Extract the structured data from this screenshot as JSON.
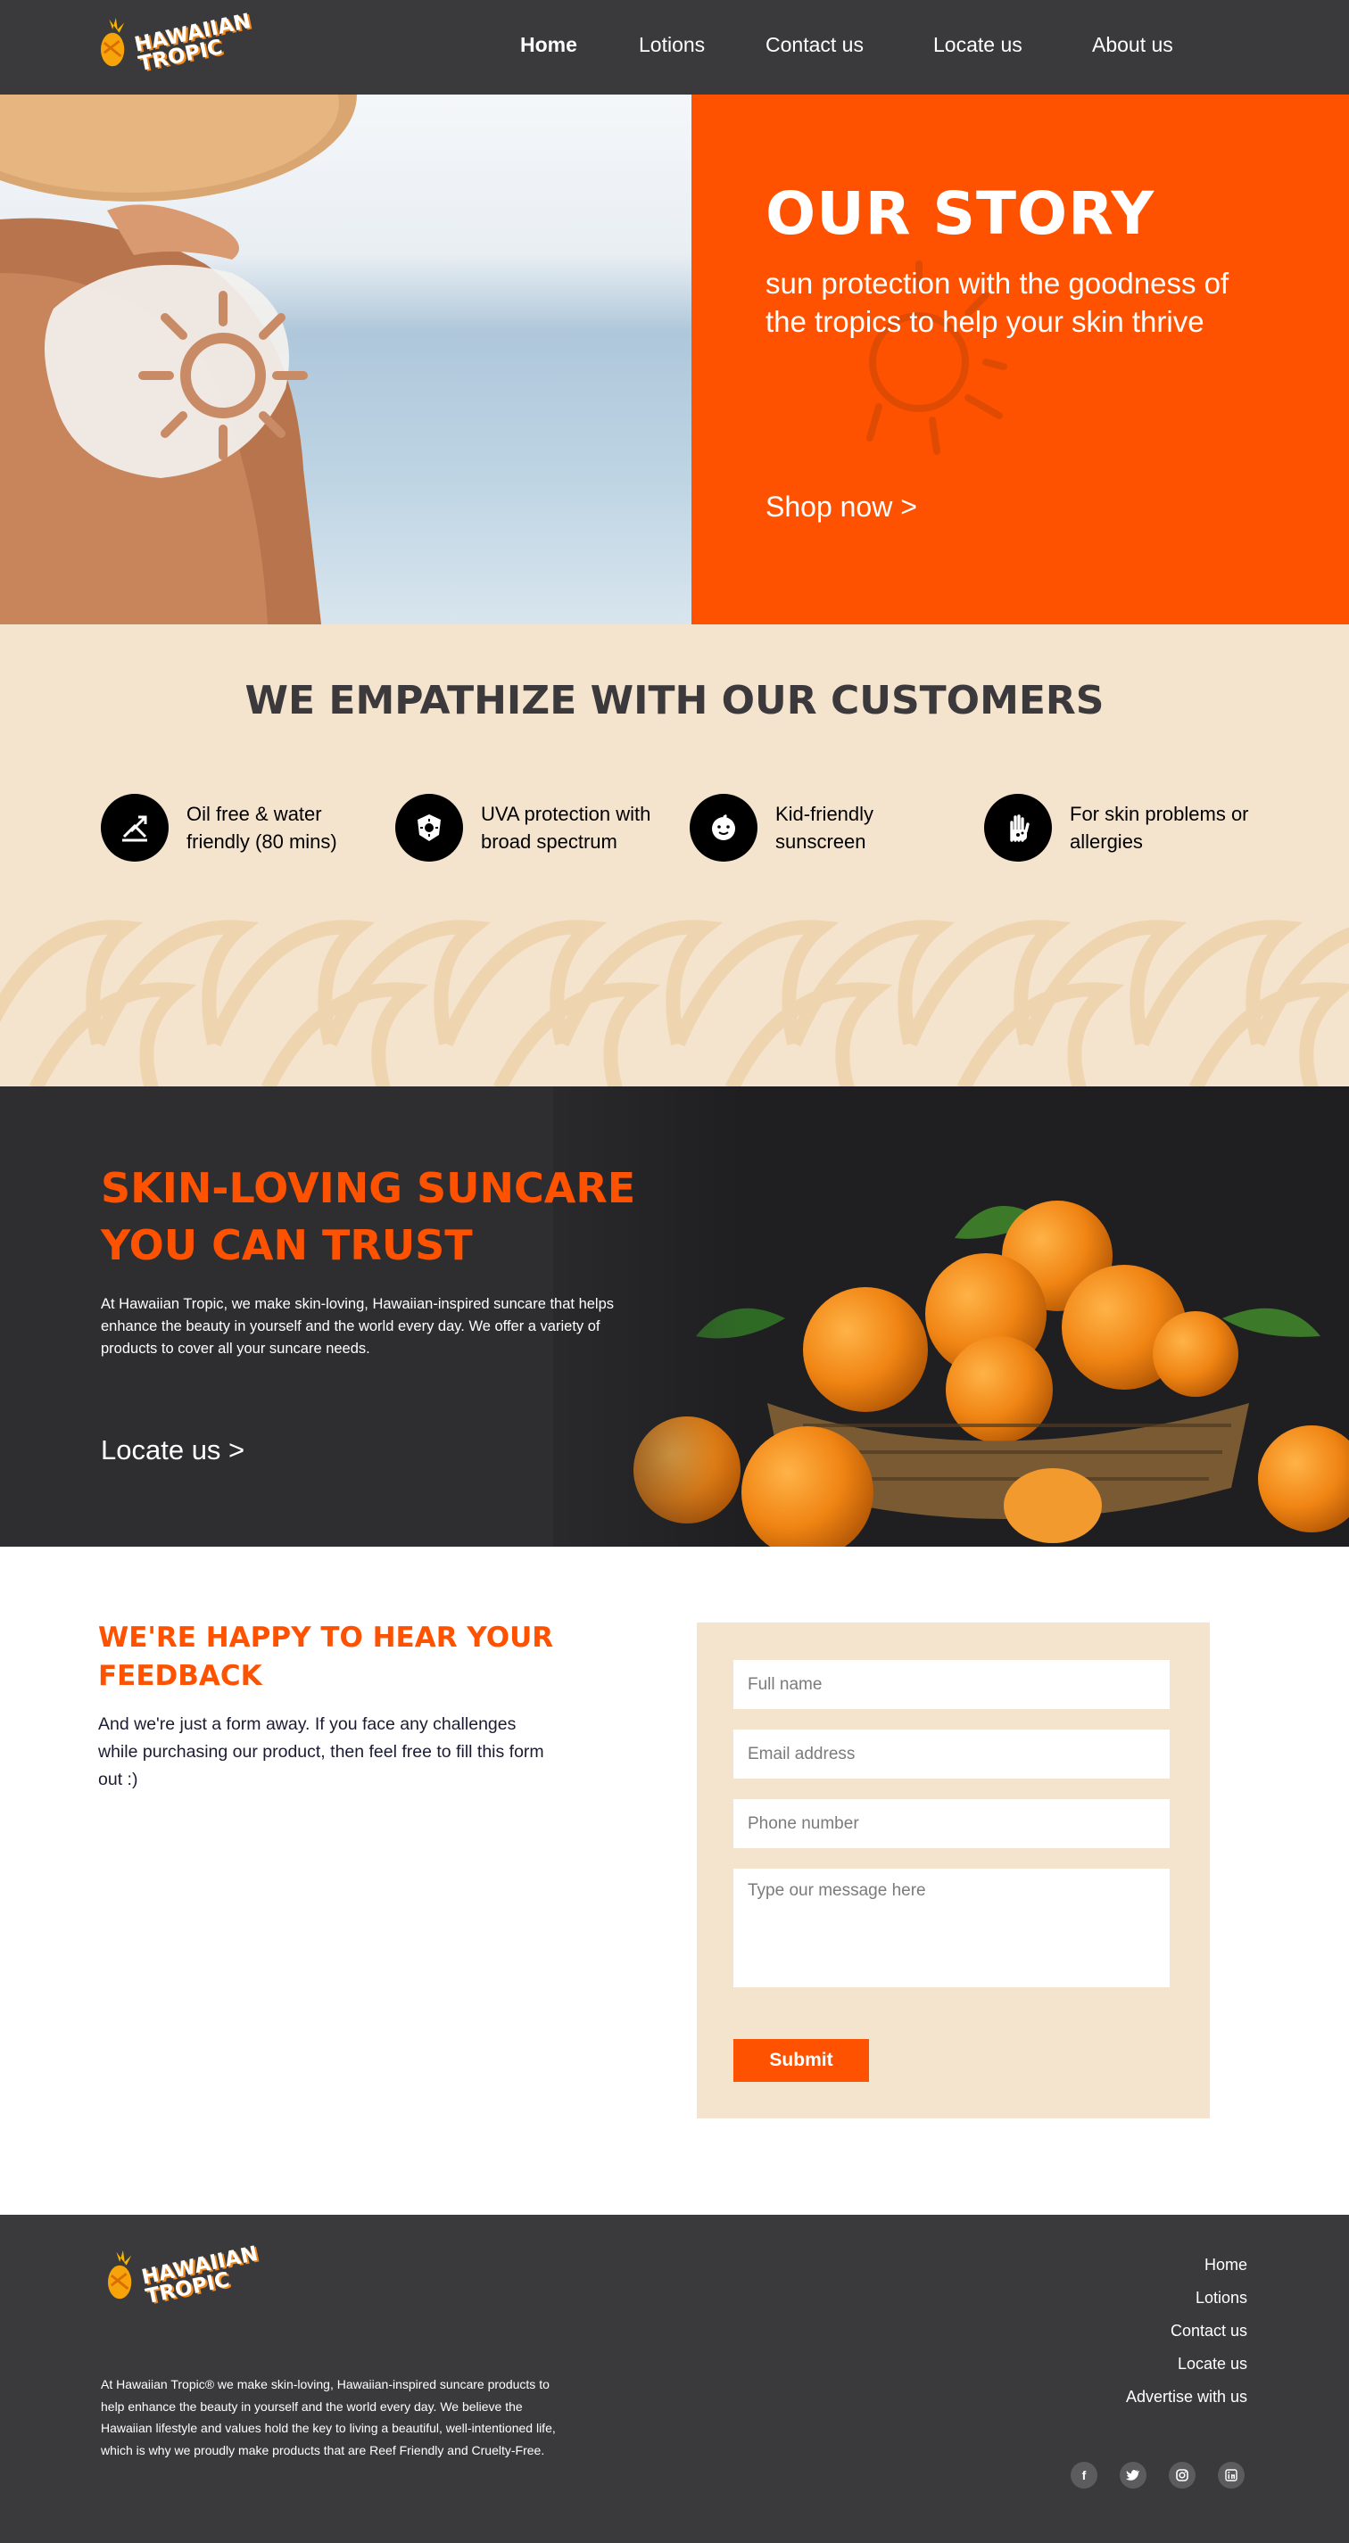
{
  "brand": {
    "name_line1": "HAWAIIAN",
    "name_line2": "TROPIC"
  },
  "nav": {
    "items": [
      {
        "label": "Home",
        "active": true
      },
      {
        "label": "Lotions"
      },
      {
        "label": "Contact us"
      },
      {
        "label": "Locate us"
      },
      {
        "label": "About us"
      }
    ]
  },
  "hero": {
    "title": "OUR STORY",
    "subtitle": "sun protection with the goodness of the tropics to help your skin thrive",
    "cta": "Shop now >"
  },
  "empathize": {
    "title": "WE EMPATHIZE WITH OUR CUSTOMERS",
    "features": [
      {
        "icon": "water-resistant-icon",
        "label": "Oil free & water friendly (80 mins)"
      },
      {
        "icon": "sun-shield-icon",
        "label": "UVA protection with broad spectrum"
      },
      {
        "icon": "baby-face-icon",
        "label": "Kid-friendly sunscreen"
      },
      {
        "icon": "hand-allergy-icon",
        "label": "For skin problems or allergies"
      }
    ]
  },
  "trust": {
    "title": "SKIN-LOVING SUNCARE YOU CAN TRUST",
    "body": "At Hawaiian Tropic, we make skin-loving, Hawaiian-inspired suncare that helps enhance the beauty in yourself and the world every day. We offer a variety of products to cover all your suncare needs.",
    "cta": "Locate us >"
  },
  "feedback": {
    "title": "WE'RE HAPPY TO HEAR YOUR FEEDBACK",
    "body": "And we're just a form away. If you face any challenges while purchasing our product, then feel free to fill this form out :)",
    "form": {
      "full_name_placeholder": "Full name",
      "email_placeholder": "Email address",
      "phone_placeholder": "Phone number",
      "message_placeholder": "Type our message here",
      "submit_label": "Submit"
    }
  },
  "footer": {
    "about": "At Hawaiian Tropic® we make skin-loving, Hawaiian-inspired suncare products to help enhance the beauty in yourself and the world every day. We believe the Hawaiian lifestyle and values hold the key to living a beautiful, well-intentioned life, which is why we proudly make products that are Reef Friendly and Cruelty-Free.",
    "links": [
      "Home",
      "Lotions",
      "Contact us",
      "Locate us",
      "Advertise with us"
    ],
    "socials": [
      "facebook-icon",
      "twitter-icon",
      "instagram-icon",
      "linkedin-icon"
    ]
  },
  "colors": {
    "accent": "#ff5200",
    "dark": "#3a393b",
    "cream": "#f4e3cd"
  }
}
